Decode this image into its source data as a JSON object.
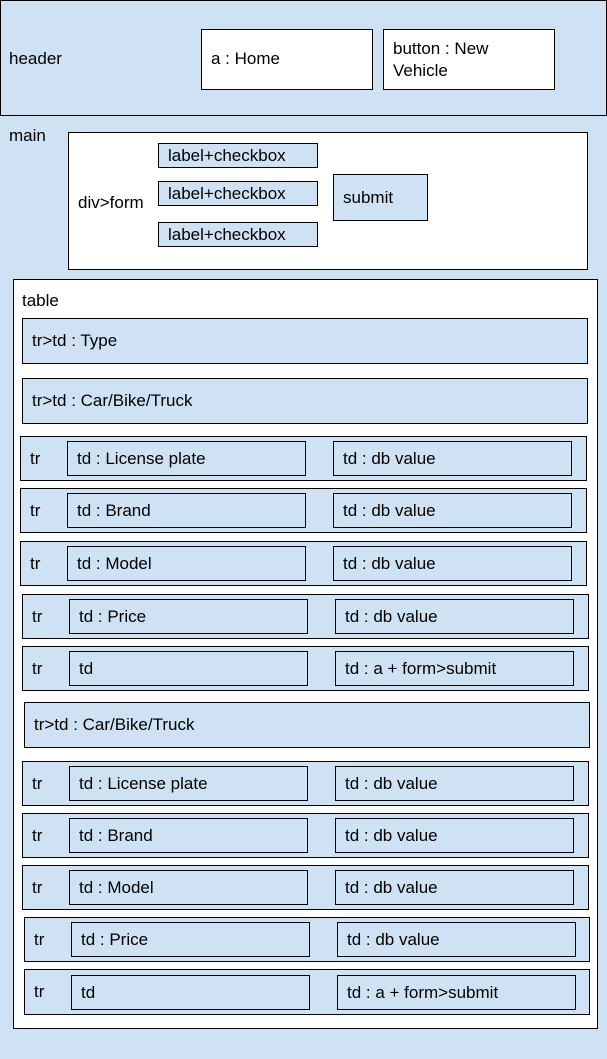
{
  "header": {
    "label": "header",
    "home_link": "a : Home",
    "new_vehicle_button": "button : New Vehicle"
  },
  "main": {
    "label": "main",
    "form": {
      "label": "div>form",
      "checkboxes": [
        "label+checkbox",
        "label+checkbox",
        "label+checkbox"
      ],
      "submit": "submit"
    },
    "table": {
      "label": "table",
      "type_row": "tr>td : Type",
      "groups": [
        {
          "heading": "tr>td : Car/Bike/Truck",
          "rows": [
            {
              "tr": "tr",
              "key": "td : License plate",
              "value": "td : db value"
            },
            {
              "tr": "tr",
              "key": "td : Brand",
              "value": "td : db value"
            },
            {
              "tr": "tr",
              "key": "td : Model",
              "value": "td : db value"
            },
            {
              "tr": "tr",
              "key": "td : Price",
              "value": "td : db value"
            },
            {
              "tr": "tr",
              "key": "td",
              "value": "td : a + form>submit"
            }
          ]
        },
        {
          "heading": "tr>td : Car/Bike/Truck",
          "rows": [
            {
              "tr": "tr",
              "key": "td : License plate",
              "value": "td : db value"
            },
            {
              "tr": "tr",
              "key": "td : Brand",
              "value": "td : db value"
            },
            {
              "tr": "tr",
              "key": "td : Model",
              "value": "td : db value"
            },
            {
              "tr": "tr",
              "key": "td : Price",
              "value": "td : db value"
            },
            {
              "tr": "tr",
              "key": "td",
              "value": "td : a + form>submit"
            }
          ]
        }
      ]
    }
  }
}
